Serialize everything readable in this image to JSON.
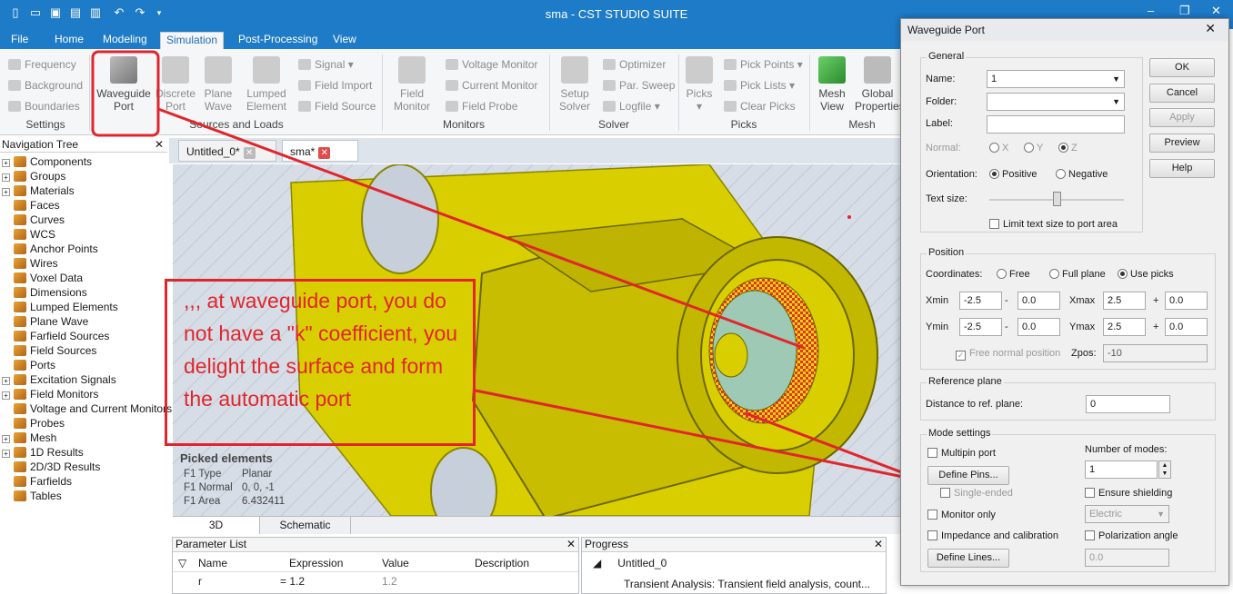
{
  "window": {
    "title": "sma - CST STUDIO SUITE",
    "minimize": "–",
    "restore": "❐",
    "close": "✕"
  },
  "menu": {
    "file": "File",
    "tabs": [
      "Home",
      "Modeling",
      "Simulation",
      "Post-Processing",
      "View"
    ]
  },
  "ribbon": {
    "settings": {
      "items": [
        "Frequency",
        "Background",
        "Boundaries"
      ],
      "group": "Settings"
    },
    "sources": {
      "big": [
        "Waveguide\nPort",
        "Discrete\nPort",
        "Plane\nWave",
        "Lumped\nElement"
      ],
      "small": [
        "Signal ▾",
        "Field Import",
        "Field Source"
      ],
      "group": "Sources and Loads"
    },
    "monitors": {
      "big": "Field\nMonitor",
      "small": [
        "Voltage Monitor",
        "Current Monitor",
        "Field Probe"
      ],
      "group": "Monitors"
    },
    "solver": {
      "big": "Setup\nSolver",
      "small": [
        "Optimizer",
        "Par. Sweep",
        "Logfile ▾"
      ],
      "group": "Solver"
    },
    "picks": {
      "big": "Picks\n▾",
      "small": [
        "Pick Points ▾",
        "Pick Lists ▾",
        "Clear Picks"
      ],
      "group": "Picks"
    },
    "mesh": {
      "big": [
        "Mesh\nView",
        "Global\nProperties"
      ],
      "group": "Mesh"
    }
  },
  "nav": {
    "title": "Navigation Tree",
    "close": "✕",
    "items": [
      {
        "label": "Components",
        "exp": true
      },
      {
        "label": "Groups",
        "exp": true
      },
      {
        "label": "Materials",
        "exp": true
      },
      {
        "label": "Faces",
        "exp": false
      },
      {
        "label": "Curves",
        "exp": false
      },
      {
        "label": "WCS",
        "exp": false
      },
      {
        "label": "Anchor Points",
        "exp": false
      },
      {
        "label": "Wires",
        "exp": false
      },
      {
        "label": "Voxel Data",
        "exp": false
      },
      {
        "label": "Dimensions",
        "exp": false
      },
      {
        "label": "Lumped Elements",
        "exp": false
      },
      {
        "label": "Plane Wave",
        "exp": false
      },
      {
        "label": "Farfield Sources",
        "exp": false
      },
      {
        "label": "Field Sources",
        "exp": false
      },
      {
        "label": "Ports",
        "exp": false
      },
      {
        "label": "Excitation Signals",
        "exp": true
      },
      {
        "label": "Field Monitors",
        "exp": true
      },
      {
        "label": "Voltage and Current Monitors",
        "exp": false
      },
      {
        "label": "Probes",
        "exp": false
      },
      {
        "label": "Mesh",
        "exp": true
      },
      {
        "label": "1D Results",
        "exp": true
      },
      {
        "label": "2D/3D Results",
        "exp": false
      },
      {
        "label": "Farfields",
        "exp": false
      },
      {
        "label": "Tables",
        "exp": false
      }
    ]
  },
  "doc_tabs": [
    {
      "label": "Untitled_0*",
      "close": "✕"
    },
    {
      "label": "sma*",
      "close": "✕"
    }
  ],
  "picked": {
    "title": "Picked elements",
    "rows": [
      [
        "F1 Type",
        "Planar"
      ],
      [
        "F1 Normal",
        "0, 0, -1"
      ],
      [
        "F1 Area",
        "6.432411"
      ]
    ]
  },
  "bottom_tabs": [
    "3D",
    "Schematic"
  ],
  "param_list": {
    "title": "Parameter List",
    "close": "✕",
    "headers": [
      "Name",
      "Expression",
      "Value",
      "Description"
    ],
    "rows": [
      [
        "r",
        "= 1.2",
        "1.2",
        ""
      ]
    ]
  },
  "progress": {
    "title": "Progress",
    "close": "✕",
    "tree": "Untitled_0",
    "task": "Transient Analysis: Transient field analysis, count..."
  },
  "annotation": {
    "text": ",,, at waveguide port, you do not have a \"k\" coefficient, you delight the surface and form the automatic port"
  },
  "dialog": {
    "title": "Waveguide Port",
    "close": "✕",
    "buttons": {
      "ok": "OK",
      "cancel": "Cancel",
      "apply": "Apply",
      "preview": "Preview",
      "help": "Help"
    },
    "general": {
      "legend": "General",
      "name_label": "Name:",
      "name_value": "1",
      "folder_label": "Folder:",
      "folder_value": "",
      "label_label": "Label:",
      "label_value": "",
      "normal_label": "Normal:",
      "normal_opts": [
        "X",
        "Y",
        "Z"
      ],
      "orientation_label": "Orientation:",
      "orientation_opts": [
        "Positive",
        "Negative"
      ],
      "textsize_label": "Text size:",
      "limit_label": "Limit text size to port area"
    },
    "position": {
      "legend": "Position",
      "coords_label": "Coordinates:",
      "coord_opts": [
        "Free",
        "Full plane",
        "Use picks"
      ],
      "xmin_label": "Xmin",
      "xmin": "-2.5",
      "xmin_off": "0.0",
      "xmax_label": "Xmax",
      "xmax": "2.5",
      "xmax_off": "0.0",
      "ymin_label": "Ymin",
      "ymin": "-2.5",
      "ymin_off": "0.0",
      "ymax_label": "Ymax",
      "ymax": "2.5",
      "ymax_off": "0.0",
      "dash": "-",
      "plus": "+",
      "free_normal": "Free normal position",
      "zpos_label": "Zpos:",
      "zpos": "-10"
    },
    "refplane": {
      "legend": "Reference plane",
      "dist_label": "Distance to ref. plane:",
      "dist": "0"
    },
    "mode": {
      "legend": "Mode settings",
      "multipin": "Multipin port",
      "nmodes_label": "Number of modes:",
      "nmodes": "1",
      "define_pins": "Define Pins...",
      "single_ended": "Single-ended",
      "ensure_shielding": "Ensure shielding",
      "monitor_only": "Monitor only",
      "electric": "Electric",
      "impedance": "Impedance and calibration",
      "polarization": "Polarization angle",
      "polar_value": "0.0",
      "define_lines": "Define Lines..."
    }
  },
  "colors": {
    "titlebar": "#1e7bc8",
    "model": "#d9cf00",
    "port": "#9ec9b4",
    "annotation": "#e0262d"
  }
}
